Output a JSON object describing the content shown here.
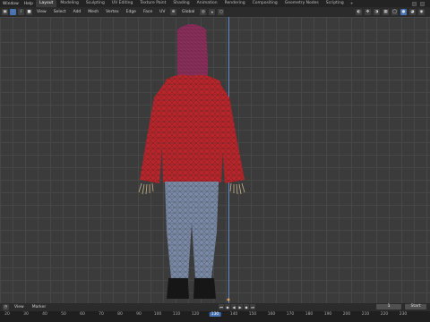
{
  "topbar": {
    "menus": [
      "Window",
      "Help"
    ],
    "workspaces": [
      "Layout",
      "Modeling",
      "Sculpting",
      "UV Editing",
      "Texture Paint",
      "Shading",
      "Animation",
      "Rendering",
      "Compositing",
      "Geometry Nodes",
      "Scripting"
    ],
    "active_workspace": "Layout",
    "add_tab": "+"
  },
  "viewport_header": {
    "menus": [
      "View",
      "Select",
      "Add",
      "Mesh",
      "Vertex",
      "Edge",
      "Face",
      "UV"
    ],
    "orientation": "Global"
  },
  "timeline": {
    "menus": [
      "View",
      "Marker"
    ],
    "current_frame": "1",
    "start_label": "Start",
    "ruler_ticks": [
      "20",
      "30",
      "40",
      "50",
      "60",
      "70",
      "80",
      "90",
      "100",
      "110",
      "120",
      "130",
      "140",
      "150",
      "160",
      "170",
      "180",
      "190",
      "200",
      "210",
      "220",
      "230"
    ],
    "current_tick": "130"
  },
  "colors": {
    "accent": "#4772b3",
    "z_axis": "#5e88c9",
    "jacket": "#b8262b",
    "jeans": "#7a8aa6",
    "hair": "#8a2e5a"
  }
}
